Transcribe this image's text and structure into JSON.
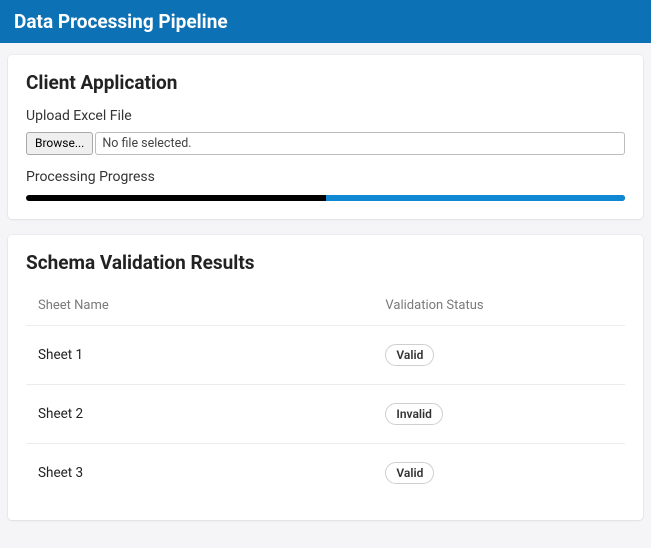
{
  "header": {
    "title": "Data Processing Pipeline"
  },
  "client": {
    "title": "Client Application",
    "upload_label": "Upload Excel File",
    "browse_label": "Browse...",
    "file_name": "No file selected.",
    "progress_label": "Processing Progress",
    "progress_percent": 50,
    "accent_color": "#1088d4"
  },
  "schema": {
    "title": "Schema Validation Results",
    "columns": {
      "sheet": "Sheet Name",
      "status": "Validation Status"
    },
    "rows": [
      {
        "sheet": "Sheet 1",
        "status": "Valid"
      },
      {
        "sheet": "Sheet 2",
        "status": "Invalid"
      },
      {
        "sheet": "Sheet 3",
        "status": "Valid"
      }
    ]
  }
}
